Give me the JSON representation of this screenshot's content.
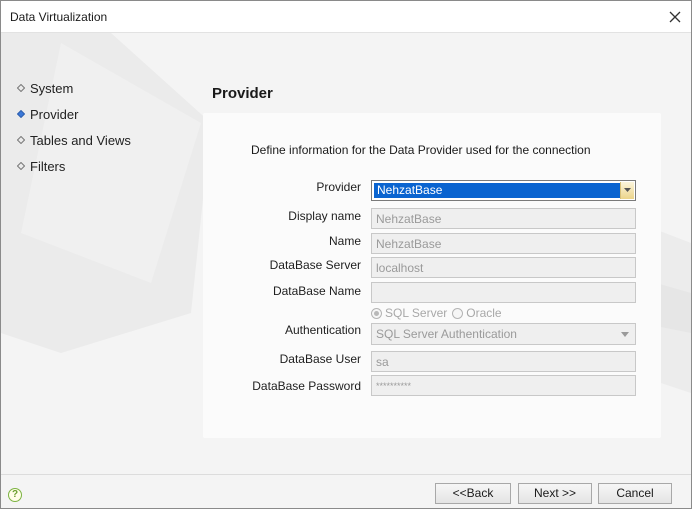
{
  "window": {
    "title": "Data Virtualization"
  },
  "nav": {
    "items": [
      {
        "label": "System",
        "active": false
      },
      {
        "label": "Provider",
        "active": true
      },
      {
        "label": "Tables and Views",
        "active": false
      },
      {
        "label": "Filters",
        "active": false
      }
    ]
  },
  "page": {
    "title": "Provider",
    "description": "Define information for the Data Provider used for the connection"
  },
  "form": {
    "provider": {
      "label": "Provider",
      "value": "NehzatBase"
    },
    "display_name": {
      "label": "Display name",
      "value": "NehzatBase"
    },
    "name": {
      "label": "Name",
      "value": "NehzatBase"
    },
    "database_server": {
      "label": "DataBase Server",
      "value": "localhost"
    },
    "database_name": {
      "label": "DataBase Name",
      "value": ""
    },
    "server_type": {
      "option1": "SQL Server",
      "option2": "Oracle",
      "selected": "SQL Server"
    },
    "authentication": {
      "label": "Authentication",
      "value": "SQL Server Authentication"
    },
    "database_user": {
      "label": "DataBase User",
      "value": "sa"
    },
    "database_password": {
      "label": "DataBase Password",
      "value": "**********"
    }
  },
  "footer": {
    "help_glyph": "?",
    "back_label": "<<Back",
    "next_label": "Next >>",
    "cancel_label": "Cancel"
  },
  "colors": {
    "selection": "#0a64d0",
    "help_green": "#7cb342",
    "active_bullet": "#3b78d8"
  },
  "icons": {
    "close": "close-icon",
    "help": "help-icon",
    "dropdown": "chevron-down-icon"
  }
}
